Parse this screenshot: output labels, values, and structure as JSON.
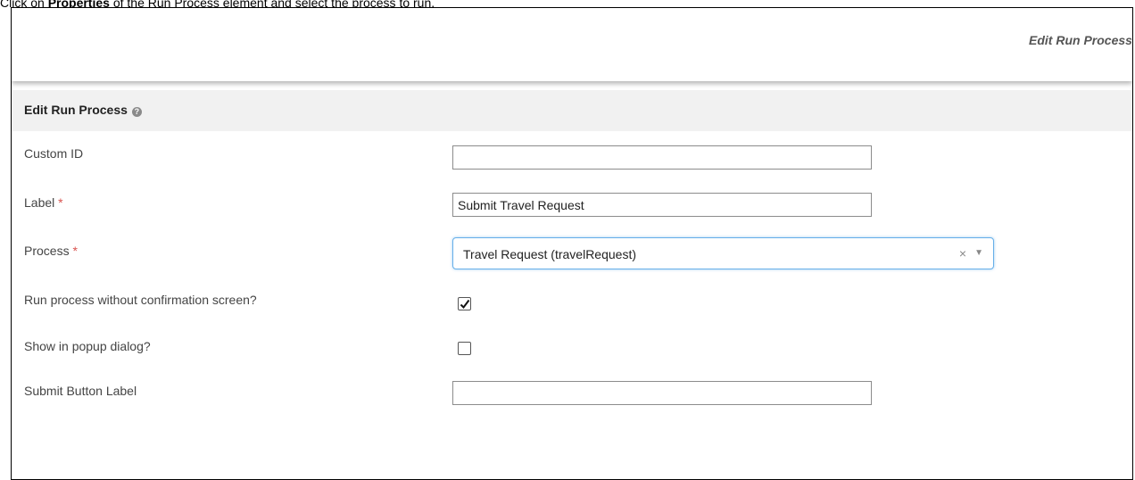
{
  "caption": {
    "prefix": "Click on ",
    "bold": "Properties",
    "suffix": " of the Run Process element and select the process to run."
  },
  "topbar": {
    "title": "Edit Run Process >"
  },
  "section": {
    "title": "Edit Run Process",
    "help_icon": "question-circle-icon"
  },
  "fields": {
    "custom_id": {
      "label": "Custom ID",
      "value": ""
    },
    "label": {
      "label": "Label",
      "required_mark": "*",
      "value": "Submit Travel Request"
    },
    "process": {
      "label": "Process",
      "required_mark": "*",
      "value": "Travel Request (travelRequest)",
      "clear_symbol": "×",
      "arrow_symbol": "▼"
    },
    "run_without_confirmation": {
      "label": "Run process without confirmation screen?",
      "checked": true
    },
    "show_in_popup": {
      "label": "Show in popup dialog?",
      "checked": false
    },
    "submit_button_label": {
      "label": "Submit Button Label",
      "value": ""
    }
  },
  "colors": {
    "required": "#d9534f",
    "focus_border": "#66afe9",
    "header_bg": "#f1f1f1"
  }
}
